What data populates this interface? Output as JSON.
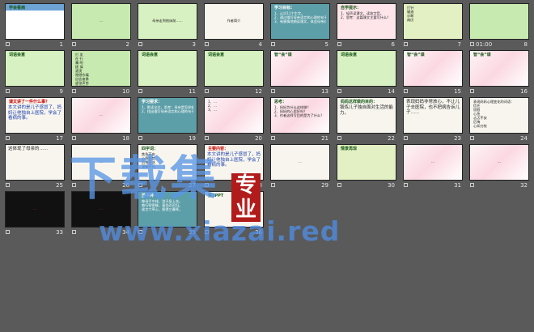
{
  "slides": [
    {
      "num": "1",
      "title": "学会看病"
    },
    {
      "num": "2",
      "text": "…"
    },
    {
      "num": "3",
      "text": "母亲走到他床前……"
    },
    {
      "num": "4",
      "text": "作者简介"
    },
    {
      "num": "5",
      "title": "学习目标：",
      "lines": [
        "1、认识11个生字。",
        "2、通过描写母亲语言和心理的句子，体会母亲感情的变化。",
        "3、有感情地朗读课文，体会母亲对儿子的爱。"
      ]
    },
    {
      "num": "6",
      "title": "自学提示：",
      "lines": [
        "1、轻声读课文，读准字音。",
        "2、思考：这篇课文主要写什么？"
      ]
    },
    {
      "num": "7",
      "lines": [
        "打针",
        "输液",
        "诊断",
        "病历"
      ]
    },
    {
      "num": "8",
      "time": "01:00"
    },
    {
      "num": "9",
      "title": "词语会意"
    },
    {
      "num": "10",
      "lines": [
        "打 发",
        "在 行",
        "嘱 咐",
        "搓 揉",
        "滚烫",
        "隐隐作痛",
        "自告奋勇",
        "虚张声势",
        "手足无措",
        "聊胜于无"
      ]
    },
    {
      "num": "11",
      "title": "词语会意"
    },
    {
      "num": "12",
      "title": "词语会意"
    },
    {
      "num": "13",
      "title": "智“会”课"
    },
    {
      "num": "14",
      "title": "词语会意"
    },
    {
      "num": "15",
      "title": "智“会”课"
    },
    {
      "num": "16",
      "title": "智“会”课"
    },
    {
      "num": "17",
      "title": "课文讲了一件什么事？",
      "body": "本文讲的是儿子感冒了，妈妈让他独自上医院，学会了看病的事。"
    },
    {
      "num": "18",
      "text": "…"
    },
    {
      "num": "19",
      "title": "学习要求：",
      "lines": [
        "1、默读全文，思考：母亲是怎样做的？",
        "2、找出描写母亲语言和心理的句子，多读几遍，体会母亲感情的变化。"
      ]
    },
    {
      "num": "20",
      "lines": [
        "1、…",
        "2、…",
        "3、…"
      ]
    },
    {
      "num": "21",
      "title": "思考：",
      "lines": [
        "1、妈妈为什么这样做？",
        "2、妈妈的心里好吗？",
        "3、作者这样写目的是为了什么？"
      ]
    },
    {
      "num": "22",
      "title": "妈妈这样做的目的：",
      "body": "锻炼儿子独自面对生活的能力。"
    },
    {
      "num": "23",
      "body": "表现妈妈非常放心，不让儿子去医院，也不把病告诉儿子……"
    },
    {
      "num": "24",
      "lines": [
        "表现妈妈心理变化的词语：",
        "信任",
        "欣慰",
        "心急",
        "忐忑不安",
        "后悔",
        "心如刀绞"
      ]
    },
    {
      "num": "25",
      "body": "这体现了母亲的……"
    },
    {
      "num": "26",
      "text": "…"
    },
    {
      "num": "27",
      "title": "四字词：",
      "lines": [
        "焦急不安",
        "心急如焚",
        "后悔不迭",
        "温暖不已"
      ]
    },
    {
      "num": "28",
      "title": "主要内容：",
      "body": "本文讲的是儿子感冒了，妈妈让他独自上医院，学会了看病的事。"
    },
    {
      "num": "29",
      "text": "…"
    },
    {
      "num": "30",
      "title": "情景再现"
    },
    {
      "num": "31",
      "text": "…"
    },
    {
      "num": "32",
      "text": "…"
    },
    {
      "num": "33",
      "text": "…"
    },
    {
      "num": "34",
      "text": "…"
    },
    {
      "num": "35",
      "title": "游子吟",
      "lines": [
        "慈母手中线，游子身上衣。",
        "临行密密缝，意恐迟迟归。",
        "谁言寸草心，报得三春晖。"
      ]
    },
    {
      "num": "36",
      "title": "第1PPT"
    }
  ],
  "watermark": {
    "chars": "下载集",
    "seal": "专业",
    "url": "www.xiazai.red"
  }
}
